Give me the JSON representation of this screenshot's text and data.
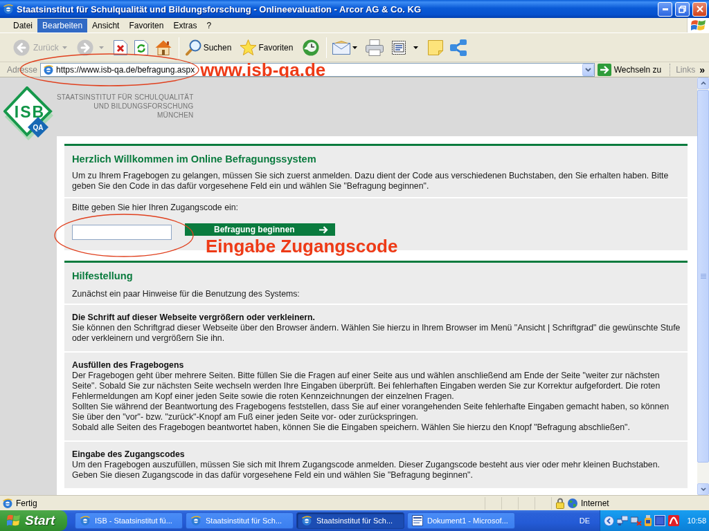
{
  "window": {
    "title": "Staatsinstitut für Schulqualität und Bildungsforschung - Onlineevaluation - Arcor AG & Co. KG"
  },
  "menu_bar": {
    "items": [
      {
        "label": "Datei",
        "selected": false
      },
      {
        "label": "Bearbeiten",
        "selected": true
      },
      {
        "label": "Ansicht",
        "selected": false
      },
      {
        "label": "Favoriten",
        "selected": false
      },
      {
        "label": "Extras",
        "selected": false
      },
      {
        "label": "?",
        "selected": false
      }
    ]
  },
  "toolbar": {
    "back": {
      "label": "Zurück",
      "disabled": true
    },
    "forward": {
      "disabled": true
    },
    "search": {
      "label": "Suchen"
    },
    "favorites": {
      "label": "Favoriten"
    }
  },
  "address_bar": {
    "label": "Adresse",
    "url": "https://www.isb-qa.de/befragung.aspx",
    "go_button": "Wechseln zu",
    "links": "Links",
    "links_more": "»"
  },
  "page": {
    "logo": {
      "text": "ISB",
      "badge": "QA"
    },
    "institute_lines": [
      "STAATSINSTITUT FÜR SCHULQUALITÄT",
      "UND BILDUNGSFORSCHUNG",
      "MÜNCHEN"
    ],
    "welcome": {
      "heading": "Herzlich Willkommen im Online Befragungssystem",
      "intro": "Um zu Ihrem Fragebogen zu gelangen, müssen Sie sich zuerst anmelden. Dazu dient der Code aus verschiedenen Buchstaben, den Sie erhalten haben. Bitte geben Sie den Code in das dafür vorgesehene Feld ein und wählen Sie \"Befragung beginnen\".",
      "prompt": "Bitte geben Sie hier Ihren Zugangscode ein:",
      "submit_button": "Befragung beginnen"
    },
    "help": {
      "heading": "Hilfestellung",
      "intro": "Zunächst ein paar Hinweise für die Benutzung des Systems:",
      "sections": [
        {
          "title": "Die Schrift auf dieser Webseite vergrößern oder verkleinern.",
          "paragraphs": [
            "Sie können den Schriftgrad dieser Webseite über den Browser ändern. Wählen Sie hierzu in Ihrem Browser im Menü \"Ansicht | Schriftgrad\" die gewünschte Stufe oder verkleinern und vergrößern Sie ihn."
          ]
        },
        {
          "title": "Ausfüllen des Fragebogens",
          "paragraphs": [
            "Der Fragebogen geht über mehrere Seiten. Bitte füllen Sie die Fragen auf einer Seite aus und wählen anschließend am Ende der Seite \"weiter zur nächsten Seite\". Sobald Sie zur nächsten Seite wechseln werden Ihre Eingaben überprüft. Bei fehlerhaften Eingaben werden Sie zur Korrektur aufgefordert. Die roten Fehlermeldungen am Kopf einer jeden Seite sowie die roten Kennzeichnungen der einzelnen Fragen.",
            "Sollten Sie während der Beantwortung des Fragebogens feststellen, dass Sie auf einer vorangehenden Seite fehlerhafte Eingaben gemacht haben, so können Sie über den \"vor\"- bzw. \"zurück\"-Knopf am Fuß einer jeden Seite vor- oder zurückspringen.",
            "Sobald alle Seiten des Fragebogen beantwortet haben, können Sie die Eingaben speichern. Wählen Sie hierzu den Knopf \"Befragung abschließen\"."
          ]
        },
        {
          "title": "Eingabe des Zugangscodes",
          "paragraphs": [
            "Um den Fragebogen auszufüllen, müssen Sie sich mit Ihrem Zugangscode anmelden. Dieser Zugangscode besteht aus vier oder mehr kleinen Buchstaben. Geben Sie diesen Zugangscode in das dafür vorgesehene Feld ein und wählen Sie \"Befragung beginnen\"."
          ]
        }
      ]
    }
  },
  "annotations": {
    "url_label": "www.isb-qa.de",
    "field_label": "Eingabe Zugangscode"
  },
  "status_bar": {
    "text": "Fertig",
    "zone": "Internet"
  },
  "taskbar": {
    "start": "Start",
    "tasks": [
      {
        "kind": "browser",
        "label": "ISB - Staatsinstitut fü...",
        "selected": false
      },
      {
        "kind": "browser",
        "label": "Staatsinstitut für Sch...",
        "selected": false
      },
      {
        "kind": "browser",
        "label": "Staatsinstitut für Sch...",
        "selected": true
      },
      {
        "kind": "word",
        "label": "Dokument1 - Microsof...",
        "selected": false
      }
    ],
    "language": "DE",
    "clock": "10:58"
  }
}
